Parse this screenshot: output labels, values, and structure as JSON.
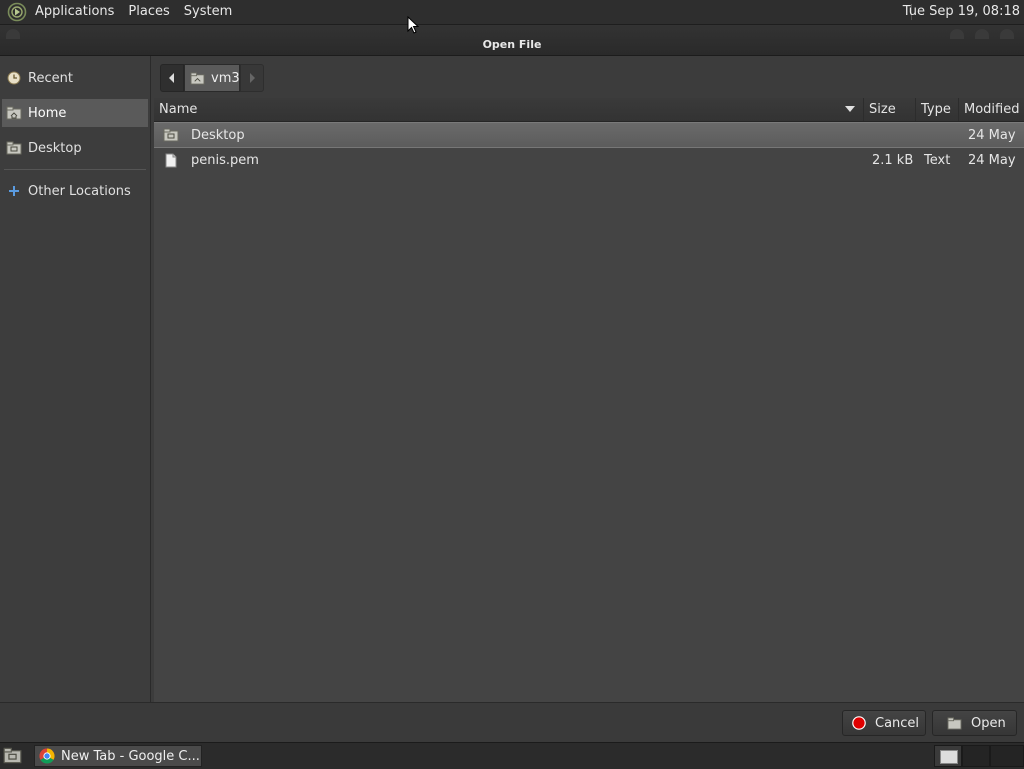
{
  "top_panel": {
    "menus": [
      "Applications",
      "Places",
      "System"
    ],
    "clock": "Tue Sep 19, 08:18"
  },
  "dialog": {
    "title": "Open File",
    "sidebar": {
      "items": [
        {
          "label": "Recent",
          "icon": "recent-clock-icon"
        },
        {
          "label": "Home",
          "icon": "home-folder-icon",
          "selected": true
        },
        {
          "label": "Desktop",
          "icon": "desktop-folder-icon"
        },
        {
          "label": "Other Locations",
          "icon": "plus-icon"
        }
      ]
    },
    "pathbar": {
      "crumb": "vm3"
    },
    "columns": {
      "name": "Name",
      "size": "Size",
      "type": "Type",
      "modified": "Modified"
    },
    "files": [
      {
        "name": "Desktop",
        "size": "",
        "type": "",
        "modified": "24 May",
        "icon": "folder-icon",
        "selected": true
      },
      {
        "name": "penis.pem",
        "size": "2.1 kB",
        "type": "Text",
        "modified": "24 May",
        "icon": "file-icon"
      }
    ],
    "buttons": {
      "cancel": "Cancel",
      "open": "Open"
    }
  },
  "taskbar": {
    "task_label": "New Tab - Google C..."
  },
  "colors": {
    "selection": "#5a5a5a",
    "cancel_icon": "#e00000",
    "accent_plus": "#5a9be0"
  }
}
